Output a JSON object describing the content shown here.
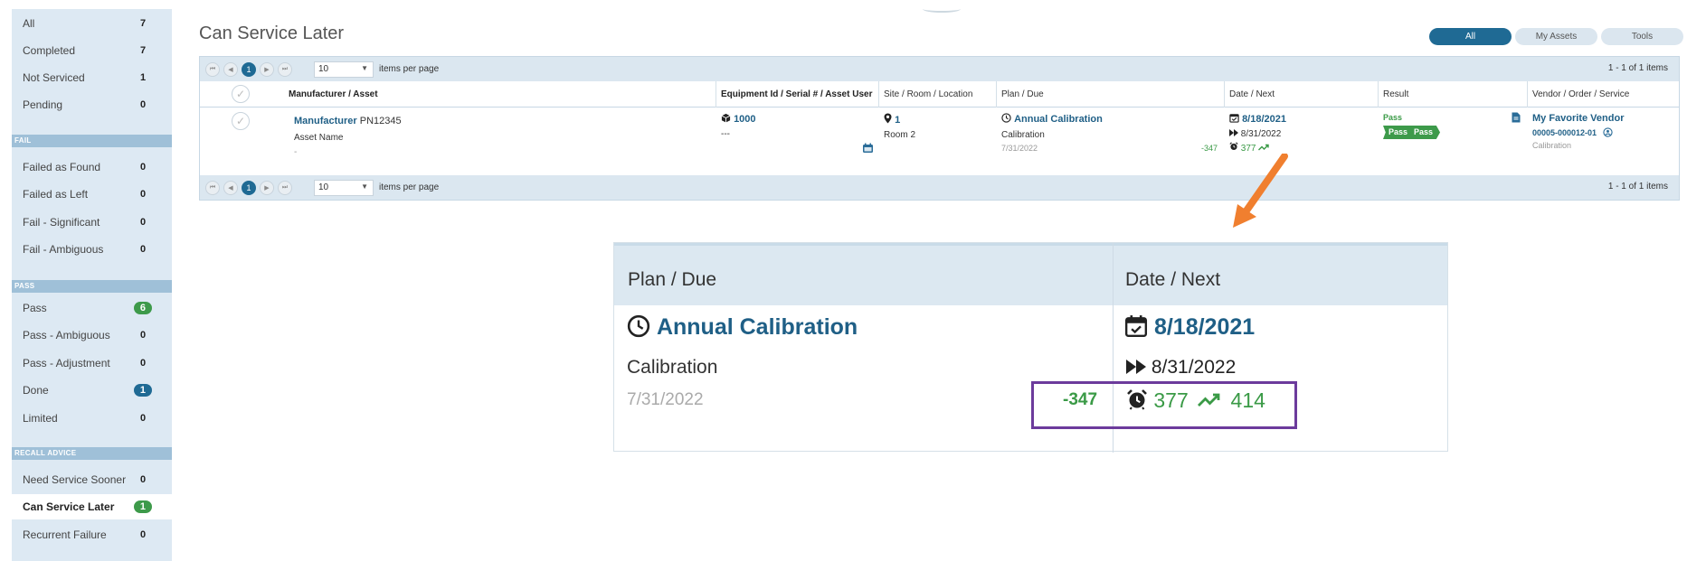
{
  "sidebar": {
    "top": [
      {
        "label": "All",
        "count": "7"
      },
      {
        "label": "Completed",
        "count": "7"
      },
      {
        "label": "Not Serviced",
        "count": "1"
      },
      {
        "label": "Pending",
        "count": "0"
      }
    ],
    "fail_section": "FAIL",
    "fail": [
      {
        "label": "Failed as Found",
        "count": "0"
      },
      {
        "label": "Failed as Left",
        "count": "0"
      },
      {
        "label": "Fail - Significant",
        "count": "0"
      },
      {
        "label": "Fail - Ambiguous",
        "count": "0"
      }
    ],
    "pass_section": "PASS",
    "pass": [
      {
        "label": "Pass",
        "count": "6"
      },
      {
        "label": "Pass - Ambiguous",
        "count": "0"
      },
      {
        "label": "Pass - Adjustment",
        "count": "0"
      },
      {
        "label": "Done",
        "count": "1"
      },
      {
        "label": "Limited",
        "count": "0"
      }
    ],
    "recall_section": "RECALL ADVICE",
    "recall": [
      {
        "label": "Need Service Sooner",
        "count": "0"
      },
      {
        "label": "Can Service Later",
        "count": "1"
      },
      {
        "label": "Recurrent Failure",
        "count": "0"
      }
    ]
  },
  "colors": {
    "pill_green": "#3d9a4a",
    "pill_blue": "#1f6a94",
    "accent": "#1f5f86",
    "highlight": "#6c3b9c",
    "arrow": "#f07f2f"
  },
  "header": {
    "title": "Can Service Later"
  },
  "filters": {
    "all": "All",
    "my_assets": "My Assets",
    "tools": "Tools"
  },
  "pager": {
    "first": "⏮",
    "prev": "◀",
    "page": "1",
    "next": "▶",
    "last": "⏭",
    "page_size": "10",
    "page_size_caret": "▼",
    "items_per_page": "items per page",
    "range": "1 - 1 of 1 items"
  },
  "columns": {
    "manufacturer_asset": "Manufacturer / Asset",
    "equipment": "Equipment Id / Serial # / Asset User",
    "site": "Site / Room / Location",
    "plan": "Plan / Due",
    "date": "Date / Next",
    "result": "Result",
    "vendor": "Vendor / Order / Service"
  },
  "row": {
    "manufacturer": "Manufacturer",
    "part_number": "PN12345",
    "asset_name": "Asset Name",
    "asset_extra": "-",
    "equipment_id": "1000",
    "serial": "---",
    "site": "1",
    "room": "Room 2",
    "plan_name": "Annual Calibration",
    "plan_type": "Calibration",
    "due_date": "7/31/2022",
    "due_diff": "-347",
    "date": "8/18/2021",
    "next_date": "8/31/2022",
    "days": "377",
    "result": "Pass",
    "result_badge_1": "Pass",
    "result_badge_2": "Pass",
    "vendor": "My Favorite Vendor",
    "order": "00005-000012-01",
    "service": "Calibration"
  },
  "zoom": {
    "plan_header": "Plan / Due",
    "date_header": "Date / Next",
    "plan_name": "Annual Calibration",
    "plan_type": "Calibration",
    "due_date": "7/31/2022",
    "due_diff": "-347",
    "date": "8/18/2021",
    "next_date": "8/31/2022",
    "days": "377",
    "interval": "414"
  }
}
